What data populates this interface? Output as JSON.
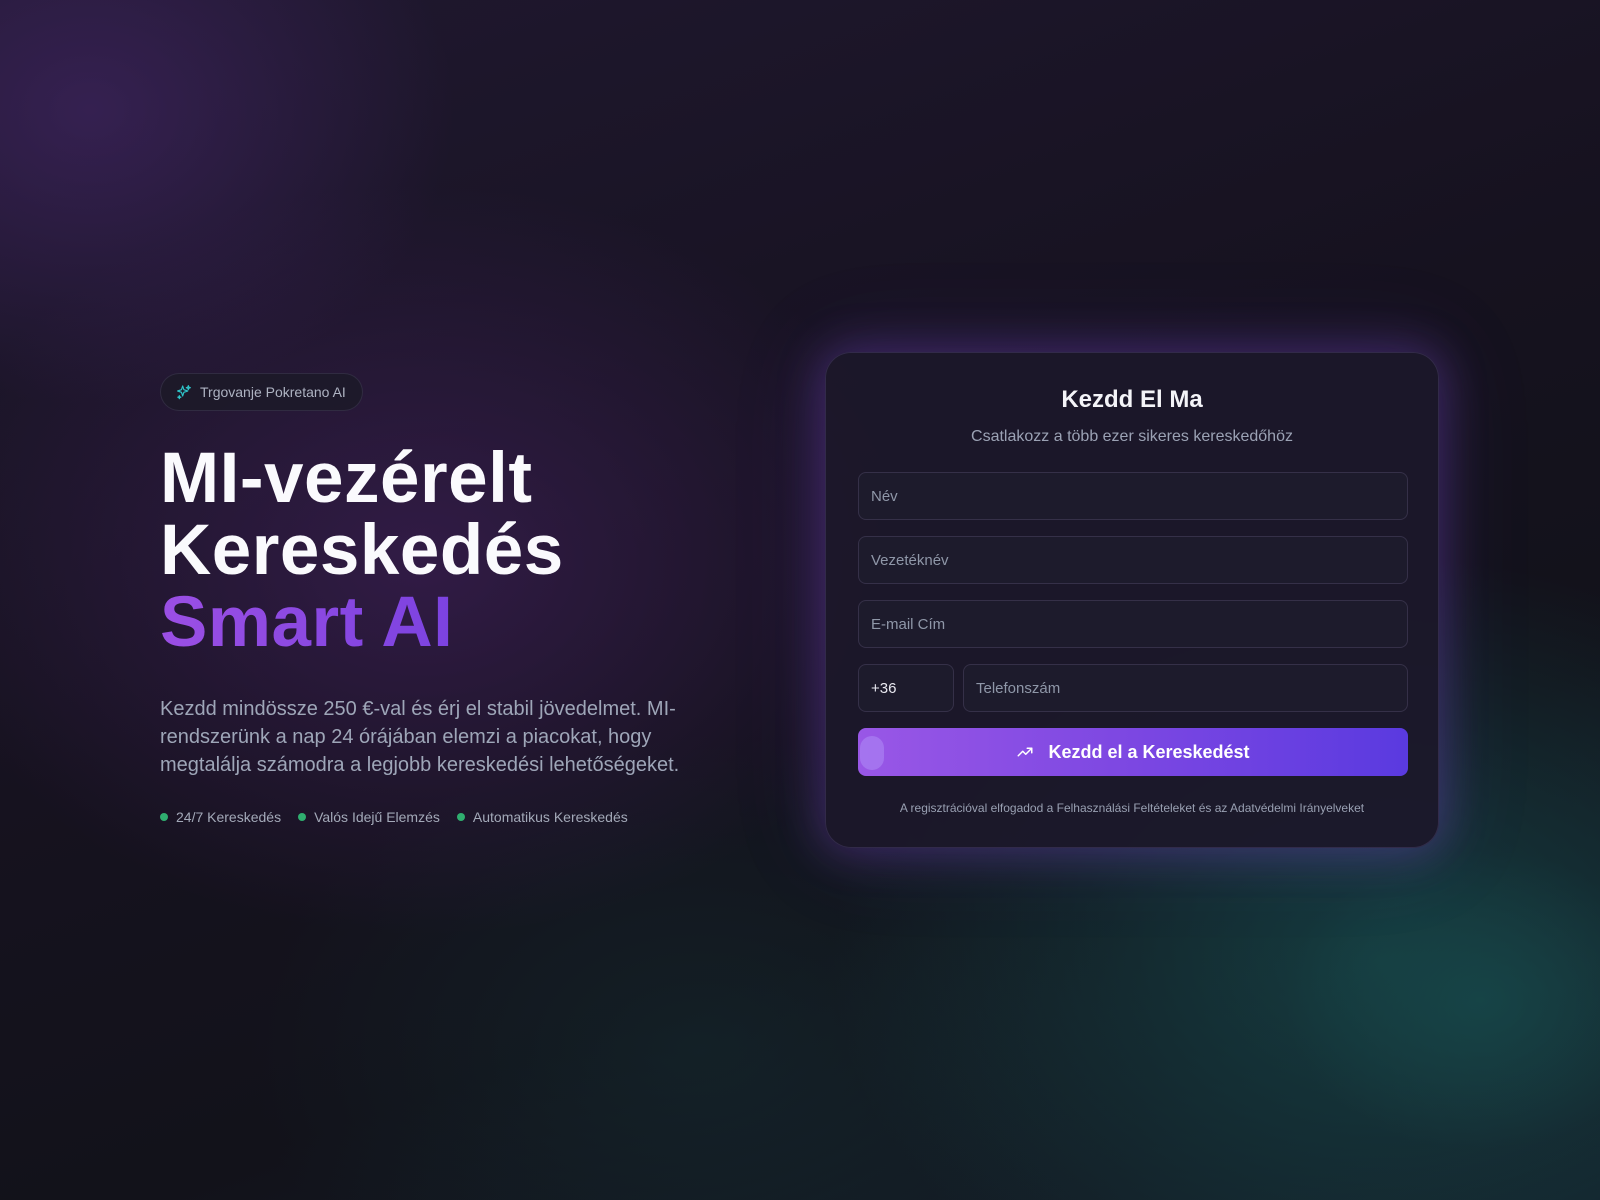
{
  "hero": {
    "badge_icon": "sparkle-icon",
    "badge_text": "Trgovanje Pokretano AI",
    "headline_line1": "MI-vezérelt",
    "headline_line2": "Kereskedés",
    "headline_line3": "Smart AI",
    "description": "Kezdd mindössze 250 €-val és érj el stabil jövedelmet. MI-rendszerünk a nap 24 órájában elemzi a piacokat, hogy megtalálja számodra a legjobb kereskedési lehetőségeket.",
    "features": [
      {
        "label": "24/7 Kereskedés"
      },
      {
        "label": "Valós Idejű Elemzés"
      },
      {
        "label": "Automatikus Kereskedés"
      }
    ],
    "feature_dot_color": "#2fae6f",
    "accent_gradient": [
      "#9b4fe4",
      "#6a3fe0"
    ]
  },
  "form": {
    "title": "Kezdd El Ma",
    "subtitle": "Csatlakozz a több ezer sikeres kereskedőhöz",
    "first_name": {
      "placeholder": "Név",
      "value": ""
    },
    "last_name": {
      "placeholder": "Vezetéknév",
      "value": ""
    },
    "email": {
      "placeholder": "E-mail Cím",
      "value": ""
    },
    "country_code": "+36",
    "phone": {
      "placeholder": "Telefonszám",
      "value": ""
    },
    "submit_icon": "trending-up-icon",
    "submit_label": "Kezdd el a Kereskedést",
    "terms": "A regisztrációval elfogadod a Felhasználási Feltételeket és az Adatvédelmi Irányelveket"
  }
}
